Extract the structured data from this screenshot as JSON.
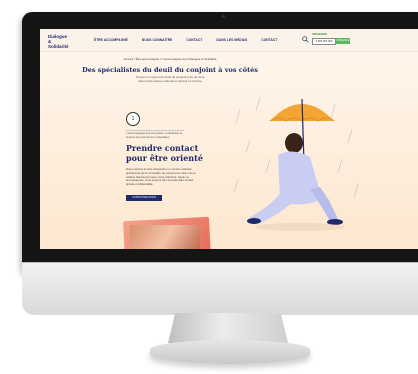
{
  "site": {
    "logo_line1": "Dialogue",
    "logo_line2": "& Solidarité",
    "nav": [
      "ÊTRE ACCOMPAGNÉ",
      "NOUS CONNAÎTRE",
      "CONTACT",
      "DANS LES MÉDIAS",
      "CONTACT"
    ],
    "urgence_label": "URGENCE",
    "phone": "0 800 000 000",
    "urgence_button": "URGENCE"
  },
  "page": {
    "breadcrumb": "Accueil  /  Être accompagné  /  L'accompagnement Dialogue & Solidarité",
    "title": "Des spécialistes du deuil du conjoint à vos côtés",
    "subtitle": "Trouvez un expert du deuil du conjoint près de vous dans notre réseau national et partout en France",
    "badge_number": "1",
    "small_note": "L'accompagnement est gratuit, confidentiel et réservé aux personnes endeuillées",
    "contact_title": "Prendre contact pour être orienté",
    "contact_body": "Nous mettons à votre disposition un numéro national gratuit ainsi qu'un formulaire de contact pour être mis en relation directement avec notre référente. Seule ou accompagnée, vous pourrez être écoutée dans la plus grande confidentialité.",
    "cta": "CONTACTEZ-NOUS"
  },
  "colors": {
    "navy": "#1d2a6b",
    "orange": "#f2a534",
    "green": "#5cb85c",
    "peach_bg": "#fde7cf"
  },
  "icons": [
    "search-icon"
  ]
}
